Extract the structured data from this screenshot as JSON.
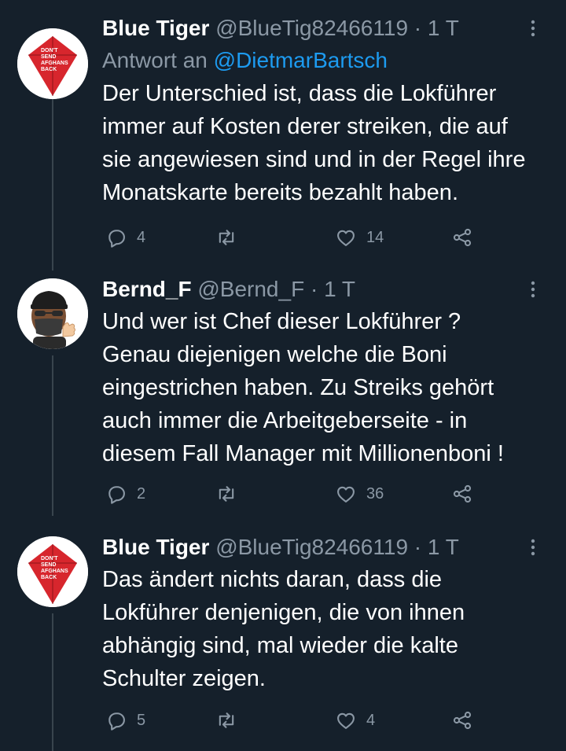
{
  "tweets": [
    {
      "name": "Blue Tiger",
      "handle": "@BlueTig82466119",
      "separator": "·",
      "time": "1 T",
      "reply_prefix": "Antwort an",
      "reply_to": "@DietmarBartsch",
      "text": "Der Unterschied ist, dass die Lokführer\nimmer auf Kosten derer streiken, die auf\nsie angewiesen sind und in der Regel ihre\nMonatskarte bereits bezahlt haben.",
      "avatar_text": [
        "DON'T",
        "SEND",
        "AFGHANS",
        "BACK"
      ],
      "replies": "4",
      "retweets": "",
      "likes": "14"
    },
    {
      "name": "Bernd_F",
      "handle": "@Bernd_F",
      "separator": "·",
      "time": "1 T",
      "text": "Und wer ist Chef dieser Lokführer ?\nGenau diejenigen welche die Boni\neingestrichen haben. Zu Streiks gehört\nauch immer die Arbeitgeberseite - in\ndiesem Fall Manager mit Millionenboni !",
      "replies": "2",
      "retweets": "",
      "likes": "36"
    },
    {
      "name": "Blue Tiger",
      "handle": "@BlueTig82466119",
      "separator": "·",
      "time": "1 T",
      "text": "Das ändert nichts daran, dass die\nLokführer denjenigen, die von ihnen\nabhängig sind, mal wieder die kalte\nSchulter zeigen.",
      "avatar_text": [
        "DON'T",
        "SEND",
        "AFGHANS",
        "BACK"
      ],
      "replies": "5",
      "retweets": "",
      "likes": "4"
    }
  ],
  "colors": {
    "background": "#15202b",
    "text": "#ffffff",
    "secondary": "#8b98a5",
    "link": "#1d9bf0",
    "thread_line": "#38444d"
  },
  "icons": [
    "more-icon",
    "reply-icon",
    "retweet-icon",
    "like-icon",
    "share-icon"
  ]
}
